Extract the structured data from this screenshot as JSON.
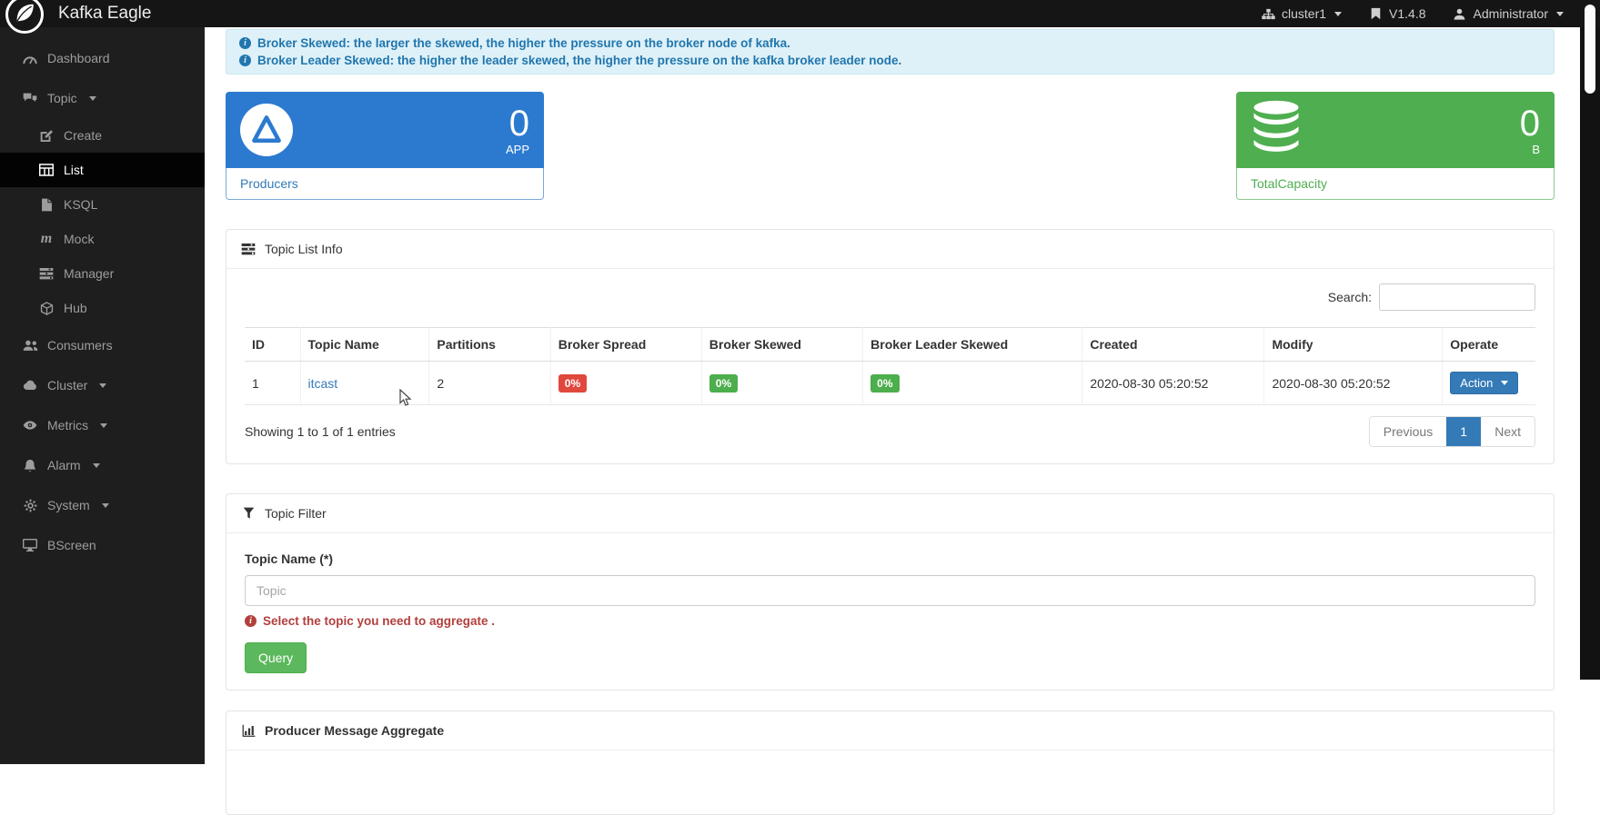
{
  "navbar": {
    "brand": "Kafka Eagle",
    "cluster": "cluster1",
    "version": "V1.4.8",
    "user": "Administrator"
  },
  "sidebar": {
    "items": [
      {
        "label": "Dashboard",
        "icon": "dashboard-icon"
      },
      {
        "label": "Topic",
        "icon": "comments-icon",
        "expanded": true
      },
      {
        "label": "Create",
        "icon": "edit-icon",
        "sub": true
      },
      {
        "label": "List",
        "icon": "table-icon",
        "sub": true,
        "active": true
      },
      {
        "label": "KSQL",
        "icon": "file-icon",
        "sub": true
      },
      {
        "label": "Mock",
        "icon": "mock-icon",
        "sub": true
      },
      {
        "label": "Manager",
        "icon": "tasks-icon",
        "sub": true
      },
      {
        "label": "Hub",
        "icon": "cube-icon",
        "sub": true
      },
      {
        "label": "Consumers",
        "icon": "users-icon"
      },
      {
        "label": "Cluster",
        "icon": "cloud-icon"
      },
      {
        "label": "Metrics",
        "icon": "eye-icon"
      },
      {
        "label": "Alarm",
        "icon": "bell-icon"
      },
      {
        "label": "System",
        "icon": "gear-icon"
      },
      {
        "label": "BScreen",
        "icon": "desktop-icon"
      }
    ]
  },
  "alerts": {
    "lines": [
      {
        "text": "Broker Skewed: the larger the skewed, the higher the pressure on the broker node of kafka."
      },
      {
        "text": "Broker Leader Skewed: the higher the leader skewed, the higher the pressure on the kafka broker leader node."
      }
    ]
  },
  "cards": {
    "producers": {
      "value": "0",
      "unit": "APP",
      "label": "Producers"
    },
    "total_capacity": {
      "value": "0",
      "unit": "B",
      "label": "TotalCapacity"
    }
  },
  "topic_list": {
    "title": "Topic List Info",
    "search_label": "Search:",
    "columns": [
      "ID",
      "Topic Name",
      "Partitions",
      "Broker Spread",
      "Broker Skewed",
      "Broker Leader Skewed",
      "Created",
      "Modify",
      "Operate"
    ],
    "row": {
      "id": "1",
      "topic_name": "itcast",
      "partitions": "2",
      "broker_spread": "0%",
      "broker_skewed": "0%",
      "broker_leader_skewed": "0%",
      "created": "2020-08-30 05:20:52",
      "modify": "2020-08-30 05:20:52",
      "action_label": "Action"
    },
    "summary": "Showing 1 to 1 of 1 entries",
    "pagination": {
      "previous": "Previous",
      "page": "1",
      "next": "Next"
    }
  },
  "topic_filter": {
    "title": "Topic Filter",
    "field_label": "Topic Name (*)",
    "placeholder": "Topic",
    "hint": "Select the topic you need to aggregate .",
    "query_label": "Query"
  },
  "producer_aggregate": {
    "title": "Producer Message Aggregate"
  },
  "colors": {
    "primary": "#337ab7",
    "card_blue": "#2b7ad0",
    "card_green": "#4fae50",
    "badge_red": "#e0483e",
    "badge_green": "#4cae4c",
    "alert_text": "#2176ad",
    "danger_text": "#b23f3d",
    "sidebar_bg": "#1e1e1e",
    "navbar_bg": "#151515"
  }
}
